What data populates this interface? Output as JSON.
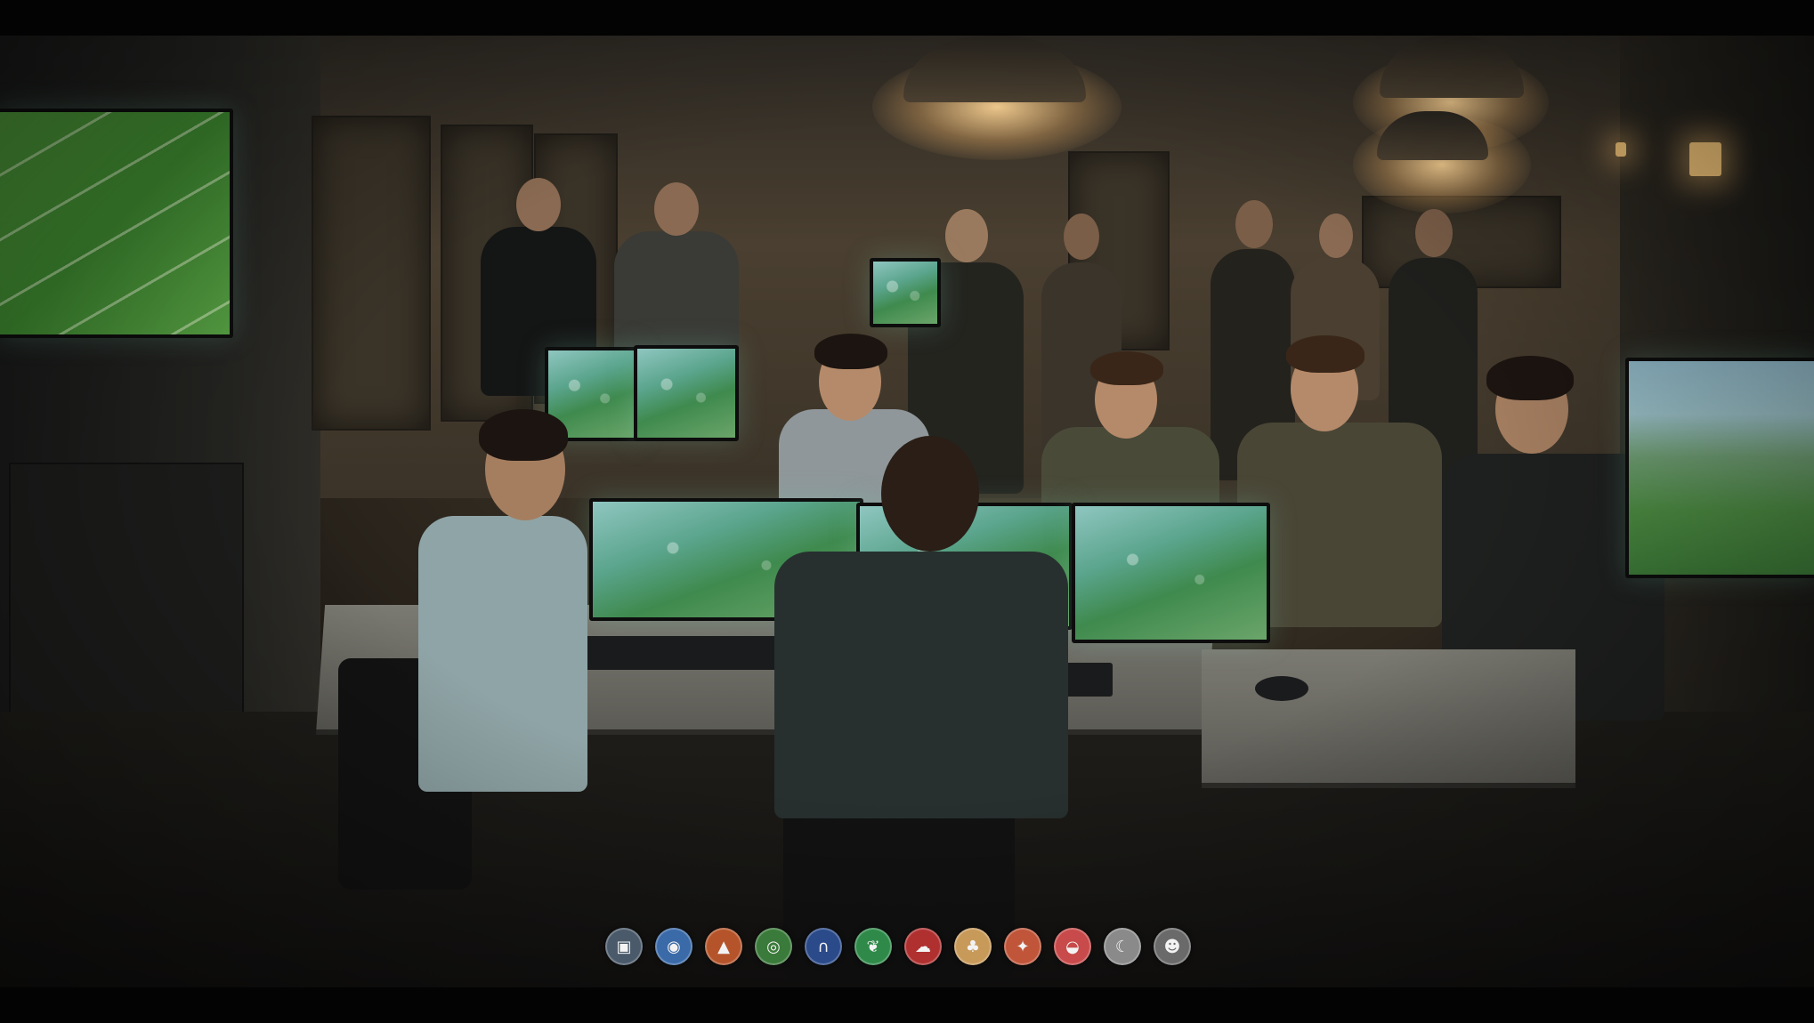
{
  "scene": {
    "palette": {
      "ambient": "#3a3226",
      "lamp_light": "#ffd696",
      "screen_green": "#4f9b3a",
      "screen_teal": "#8fc6c0"
    }
  },
  "dock": {
    "icons": [
      {
        "name": "window-icon",
        "glyph": "▣",
        "color": "#4a5a6a"
      },
      {
        "name": "globe-icon",
        "glyph": "◉",
        "color": "#3a6aa8"
      },
      {
        "name": "triangle-icon",
        "glyph": "▲",
        "color": "#b5542a"
      },
      {
        "name": "spiral-icon",
        "glyph": "◎",
        "color": "#3a7a3a"
      },
      {
        "name": "horseshoe-icon",
        "glyph": "∩",
        "color": "#2a4a8a"
      },
      {
        "name": "leaf-icon",
        "glyph": "❦",
        "color": "#2f8a4a"
      },
      {
        "name": "cloud-icon",
        "glyph": "☁",
        "color": "#b03030"
      },
      {
        "name": "bell-icon",
        "glyph": "♣",
        "color": "#c89a5a"
      },
      {
        "name": "rocket-icon",
        "glyph": "✦",
        "color": "#c0553a"
      },
      {
        "name": "lips-icon",
        "glyph": "◒",
        "color": "#c84a4a"
      },
      {
        "name": "crescent-icon",
        "glyph": "☾",
        "color": "#8a8a8a"
      },
      {
        "name": "helmet-icon",
        "glyph": "☻",
        "color": "#6a6a6a"
      }
    ]
  }
}
